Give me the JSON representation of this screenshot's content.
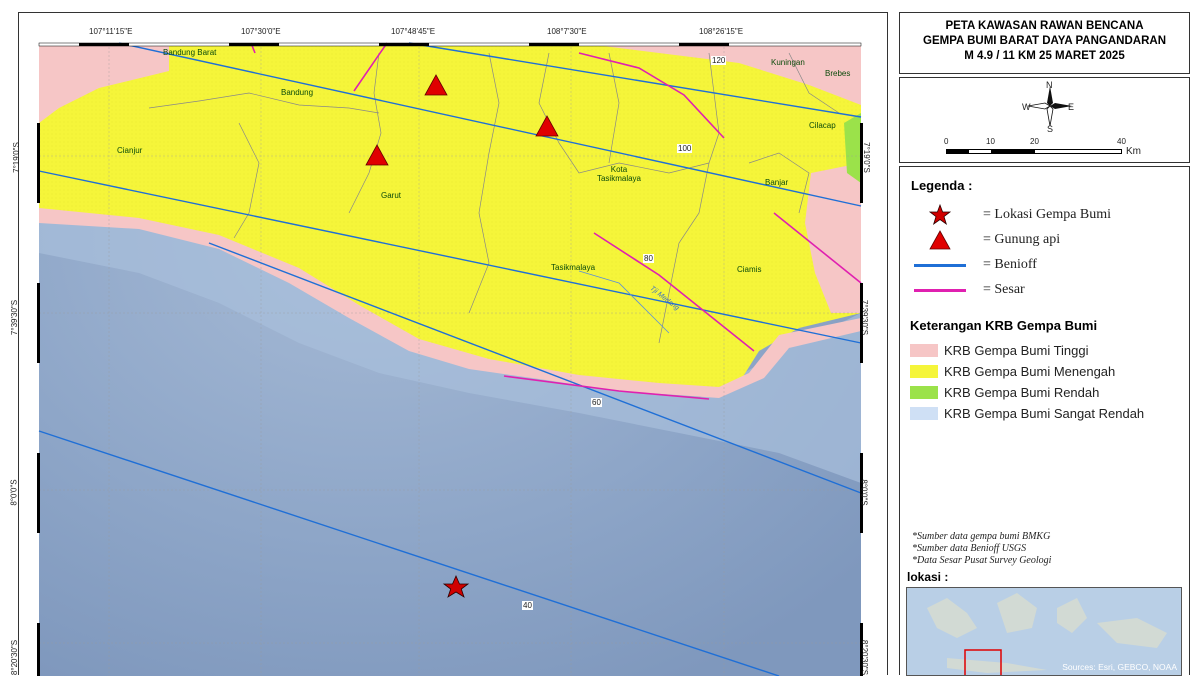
{
  "map": {
    "top_lon_labels": [
      "107°11'15\"E",
      "107°30'0\"E",
      "107°48'45\"E",
      "108°7'30\"E",
      "108°26'15\"E"
    ],
    "left_lat_labels": [
      "7°19'0\"S",
      "7°39'30\"S",
      "8°0'0\"S",
      "8°20'30\"S"
    ],
    "right_lat_labels": [
      "7°19'0\"S",
      "7°39'30\"S",
      "8°0'0\"S",
      "8°20'30\"S"
    ],
    "place_labels": [
      {
        "name": "Bandung Barat"
      },
      {
        "name": "Bandung"
      },
      {
        "name": "Cianjur"
      },
      {
        "name": "Garut"
      },
      {
        "name": "Kota Tasikmalaya"
      },
      {
        "name": "Tasikmalaya"
      },
      {
        "name": "Ciamis"
      },
      {
        "name": "Banjar"
      },
      {
        "name": "Kuningan"
      },
      {
        "name": "Brebes"
      },
      {
        "name": "Cilacap"
      }
    ],
    "benioff_contour_labels": [
      "120",
      "100",
      "80",
      "60",
      "40"
    ],
    "river_label": "Tji Medang",
    "colors": {
      "sea": "#8fa7c8",
      "land_moderate": "#f5f53a",
      "land_high": "#f6c6c6",
      "land_low": "#9be24a",
      "benioff": "#1f6fd6",
      "fault": "#e020b0",
      "volcano": "#e00000",
      "epicenter": "#d00000"
    }
  },
  "title": {
    "line1": "PETA KAWASAN RAWAN BENCANA",
    "line2": "GEMPA BUMI BARAT DAYA PANGANDARAN",
    "line3": "M 4.9 / 11 KM  25 MARET 2025"
  },
  "north_arrow": {
    "n": "N",
    "s": "S",
    "e": "E",
    "w": "W"
  },
  "scale_bar": {
    "ticks": [
      "0",
      "10",
      "20",
      "40"
    ],
    "unit": "Km"
  },
  "legend": {
    "heading": "Legenda :",
    "items": [
      {
        "symbol": "star-icon",
        "label": "= Lokasi Gempa Bumi"
      },
      {
        "symbol": "triangle-icon",
        "label": "= Gunung api"
      },
      {
        "symbol": "blue-line",
        "label": "= Benioff"
      },
      {
        "symbol": "magenta-line",
        "label": "= Sesar"
      }
    ],
    "krb_heading": "Keterangan KRB Gempa Bumi",
    "krb_items": [
      {
        "label": "KRB Gempa Bumi Tinggi",
        "color": "#f6c6c6"
      },
      {
        "label": "KRB Gempa Bumi  Menengah",
        "color": "#f5f53a"
      },
      {
        "label": "KRB Gempa Bumi Rendah",
        "color": "#9be24a"
      },
      {
        "label": "KRB Gempa Bumi Sangat Rendah",
        "color": "#cfe0f5"
      }
    ],
    "sources": [
      "*Sumber data gempa bumi BMKG",
      "*Sumber data Benioff USGS",
      "*Data Sesar Pusat Survey Geologi"
    ],
    "location_heading": "lokasi :",
    "inset_credit": "Sources: Esri, GEBCO, NOAA"
  }
}
